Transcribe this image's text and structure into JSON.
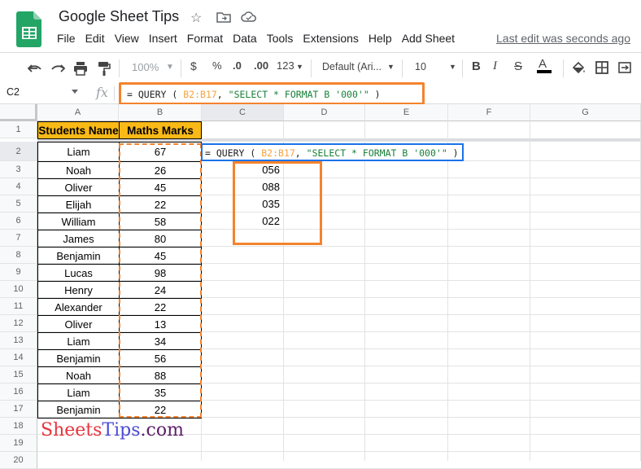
{
  "title_bar": {
    "doc_title": "Google Sheet Tips",
    "last_edit": "Last edit was seconds ago"
  },
  "menu": [
    "File",
    "Edit",
    "View",
    "Insert",
    "Format",
    "Data",
    "Tools",
    "Extensions",
    "Help",
    "Add Sheet"
  ],
  "toolbar": {
    "zoom": "100%",
    "currency": "$",
    "percent": "%",
    "dec_decrease": ".0",
    "dec_increase": ".00",
    "more_formats": "123",
    "font": "Default (Ari...",
    "font_size": "10",
    "bold": "B",
    "italic": "I",
    "strike": "S",
    "text_color": "A"
  },
  "formula_bar": {
    "name_box": "C2",
    "fx": "fx",
    "f_prefix": "= QUERY ( ",
    "f_range": "B2:B17",
    "f_mid": ", ",
    "f_string": "\"SELECT * FORMAT B '000'\"",
    "f_suffix": " )"
  },
  "columns": [
    "A",
    "B",
    "C",
    "D",
    "E",
    "F",
    "G"
  ],
  "rows": [
    "1",
    "2",
    "3",
    "4",
    "5",
    "6",
    "7",
    "8",
    "9",
    "10",
    "11",
    "12",
    "13",
    "14",
    "15",
    "16",
    "17",
    "18",
    "19",
    "20"
  ],
  "headers": {
    "a1": "Students Name",
    "b1": "Maths Marks"
  },
  "students": [
    {
      "name": "Liam",
      "marks": "67"
    },
    {
      "name": "Noah",
      "marks": "26"
    },
    {
      "name": "Oliver",
      "marks": "45"
    },
    {
      "name": "Elijah",
      "marks": "22"
    },
    {
      "name": "William",
      "marks": "58"
    },
    {
      "name": "James",
      "marks": "80"
    },
    {
      "name": "Benjamin",
      "marks": "45"
    },
    {
      "name": "Lucas",
      "marks": "98"
    },
    {
      "name": "Henry",
      "marks": "24"
    },
    {
      "name": "Alexander",
      "marks": "22"
    },
    {
      "name": "Oliver",
      "marks": "13"
    },
    {
      "name": "Liam",
      "marks": "34"
    },
    {
      "name": "Benjamin",
      "marks": "56"
    },
    {
      "name": "Noah",
      "marks": "88"
    },
    {
      "name": "Liam",
      "marks": "35"
    },
    {
      "name": "Benjamin",
      "marks": "22"
    }
  ],
  "query_results": [
    "056",
    "088",
    "035",
    "022"
  ],
  "watermark": {
    "part1": "Sheets",
    "part2": "Tips",
    "part3": ".com"
  },
  "colors": {
    "header_fill": "#f9b916",
    "highlight": "#f4832d",
    "active_border": "#1a73e8",
    "range_color": "#f6a23c",
    "string_color": "#188038"
  }
}
